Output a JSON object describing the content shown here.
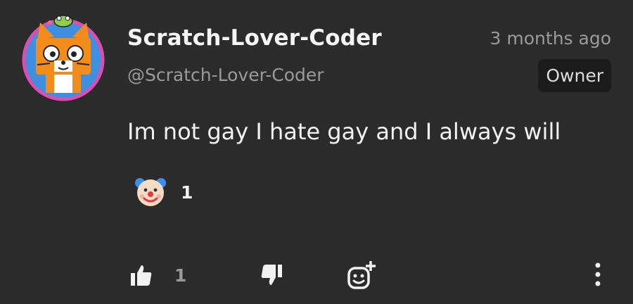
{
  "comment": {
    "author_name": "Scratch-Lover-Coder",
    "author_handle": "@Scratch-Lover-Coder",
    "timestamp": "3 months ago",
    "badge": "Owner",
    "text": "Im not gay I hate gay and I always will"
  },
  "reactions": [
    {
      "icon": "clown-face-icon",
      "count": "1"
    }
  ],
  "actions": {
    "like_count": "1",
    "like_icon": "thumbs-up-icon",
    "dislike_icon": "thumbs-down-icon",
    "add_reaction_icon": "add-emoji-icon",
    "more_icon": "more-vertical-icon"
  },
  "colors": {
    "background": "#2b2b2b",
    "text": "#f2f2f2",
    "muted": "#9a9a9a",
    "badge_bg": "#1b1b1b",
    "avatar_ring": "#d94fb1"
  }
}
